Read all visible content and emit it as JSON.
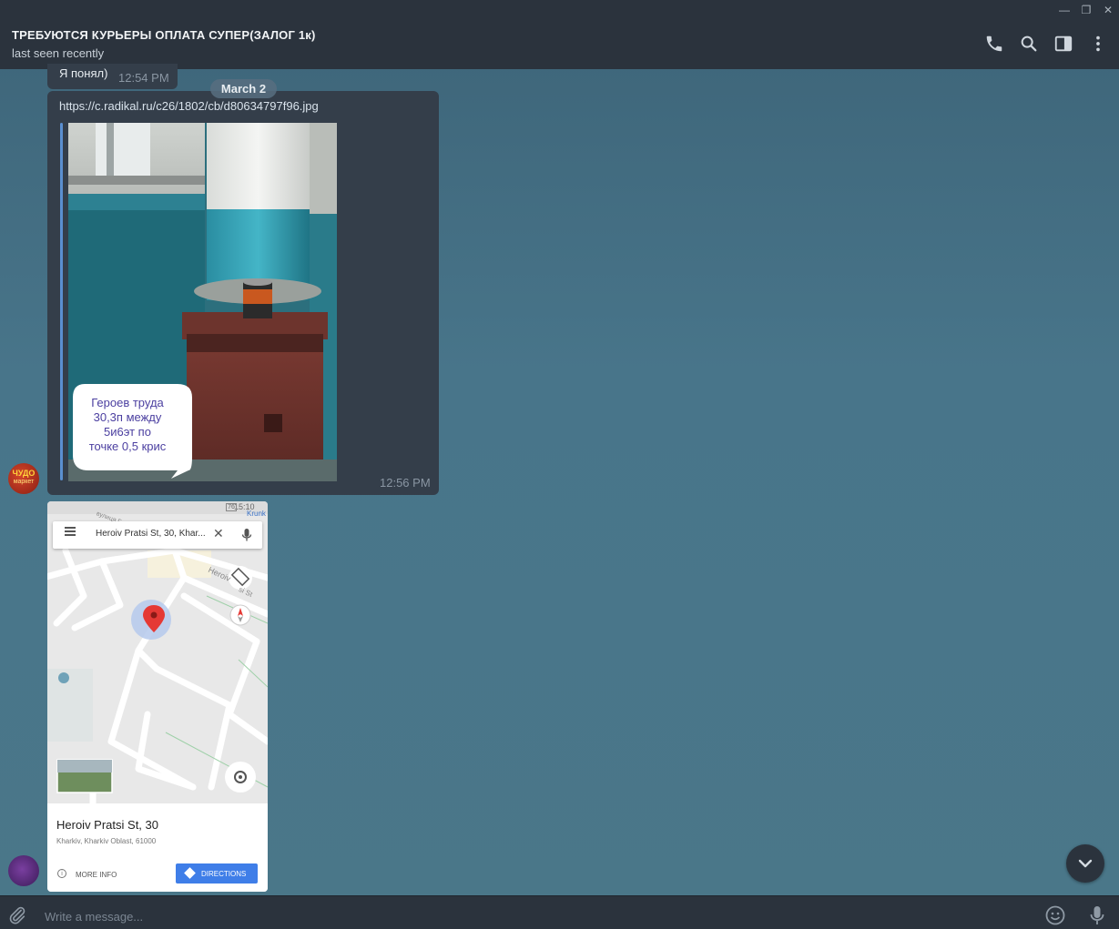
{
  "window": {
    "minimize_glyph": "—",
    "restore_glyph": "❐",
    "close_glyph": "✕"
  },
  "header": {
    "title": "ТРЕБУЮТСЯ КУРЬЕРЫ ОПЛАТА СУПЕР(ЗАЛОГ 1к)",
    "status": "last seen recently",
    "icons": [
      "phone-icon",
      "search-icon",
      "sidebar-toggle-icon",
      "more-vertical-icon"
    ]
  },
  "messages": {
    "prev": {
      "text": "Я понял)",
      "time": "12:54 PM"
    },
    "date_separator": "March 2",
    "photo_message": {
      "link": "https://c.radikal.ru/c26/1802/cb/d80634797f96.jpg",
      "caption_lines": [
        "Героев труда",
        "30,3п между",
        "5и6эт по",
        "точке 0,5 крис"
      ],
      "time": "12:56 PM"
    },
    "map_message": {
      "status_bar": {
        "time": "15:10",
        "battery": "76"
      },
      "search_text": "Heroiv Pratsi St, 30, Khar...",
      "street_labels": [
        "вулиця Г",
        "Heroiv",
        "si St",
        "Krunk"
      ],
      "place_name": "Heroiv Pratsi St, 30",
      "place_address": "Kharkiv, Kharkiv Oblast, 61000",
      "more_info": "MORE INFO",
      "directions": "DIRECTIONS"
    }
  },
  "sender_avatar_text": [
    "ЧУДО",
    "маркет"
  ],
  "composer": {
    "placeholder": "Write a message..."
  },
  "colors": {
    "header_bg": "#2b333d",
    "bubble_bg": "#343e4a",
    "accent_blue": "#5a8fd0",
    "directions_btn": "#3f7ee8",
    "map_pin": "#e53935"
  }
}
